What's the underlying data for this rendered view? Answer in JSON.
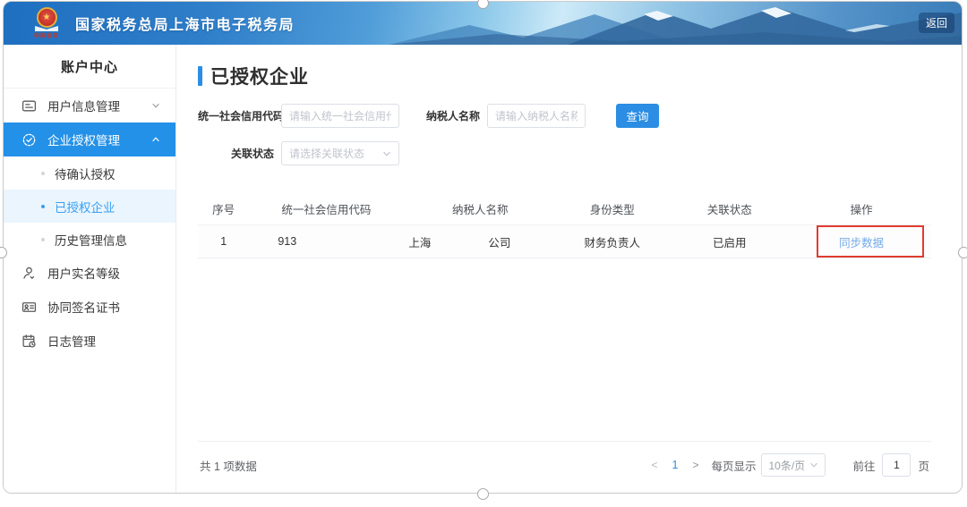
{
  "colors": {
    "accent": "#2b8de3",
    "sidebar_active_bg": "#2491e8",
    "selected_item_bg": "#eaf5fe",
    "selected_item_text": "#3aa0f0",
    "link": "#74a9e8",
    "annotation_red": "#e13b30"
  },
  "window": {
    "back_button": "返回"
  },
  "header": {
    "title": "国家税务总局上海市电子税务局",
    "logo_caption": "中国税务",
    "logo_star": "★"
  },
  "sidebar": {
    "title": "账户中心",
    "items": [
      {
        "label": "用户信息管理",
        "icon": "id-card-icon",
        "chevron": "down"
      },
      {
        "label": "企业授权管理",
        "icon": "badge-check-icon",
        "chevron": "up",
        "active": true
      },
      {
        "label": "待确认授权",
        "type": "sub"
      },
      {
        "label": "已授权企业",
        "type": "sub",
        "selected": true
      },
      {
        "label": "历史管理信息",
        "type": "sub"
      },
      {
        "label": "用户实名等级",
        "icon": "user-icon"
      },
      {
        "label": "协同签名证书",
        "icon": "certificate-icon"
      },
      {
        "label": "日志管理",
        "icon": "log-icon"
      }
    ]
  },
  "main": {
    "page_title": "已授权企业",
    "filters": {
      "credit_code_label": "统一社会信用代码",
      "credit_code_placeholder": "请输入统一社会信用代码",
      "taxpayer_name_label": "纳税人名称",
      "taxpayer_name_placeholder": "请输入纳税人名称",
      "search_button": "查询",
      "relation_status_label": "关联状态",
      "relation_status_placeholder": "请选择关联状态"
    },
    "table": {
      "headers": [
        "序号",
        "统一社会信用代码",
        "纳税人名称",
        "身份类型",
        "关联状态",
        "操作"
      ],
      "rows": [
        {
          "no": "1",
          "credit_code": "913",
          "taxpayer_name_prefix": "上海",
          "taxpayer_name_suffix": "公司",
          "identity_type": "财务负责人",
          "relation_status": "已启用",
          "action": "同步数据"
        }
      ]
    },
    "pagination": {
      "total_text": "共 1 项数据",
      "prev": "<",
      "current_page": "1",
      "next": ">",
      "page_size_label": "每页显示",
      "page_size_value": "10条/页",
      "goto_label": "前往",
      "goto_value": "1",
      "goto_unit": "页"
    }
  }
}
